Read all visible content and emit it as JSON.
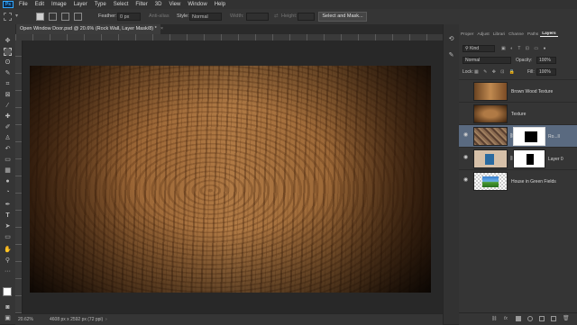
{
  "app": {
    "logo": "Ps"
  },
  "menu": [
    "File",
    "Edit",
    "Image",
    "Layer",
    "Type",
    "Select",
    "Filter",
    "3D",
    "View",
    "Window",
    "Help"
  ],
  "options": {
    "feather_label": "Feather:",
    "feather_value": "0 px",
    "antialias_label": "Anti-alias",
    "style_label": "Style:",
    "style_value": "Normal",
    "width_label": "Width:",
    "height_label": "Height:",
    "select_mask_label": "Select and Mask..."
  },
  "document": {
    "tab_title": "Open Window Door.psd @ 20.6% (Rock Wall, Layer Mask/8) *",
    "close": "×"
  },
  "status": {
    "zoom": "20.62%",
    "doc_size": "4608 px x 2592 px (72 ppi)"
  },
  "panel": {
    "tabs": [
      "Proper",
      "Adjust",
      "Librari",
      "Channe",
      "Paths",
      "Layers"
    ],
    "kind_label": "Kind",
    "blend_mode": "Normal",
    "opacity_label": "Opacity:",
    "opacity_value": "100%",
    "lock_label": "Lock:",
    "fill_label": "Fill:",
    "fill_value": "100%"
  },
  "layers": [
    {
      "name": "Brown Wood Texture",
      "visible": false
    },
    {
      "name": "Texture",
      "visible": false
    },
    {
      "name": "Ro...ll",
      "visible": true,
      "selected": true
    },
    {
      "name": "Layer 0",
      "visible": true
    },
    {
      "name": "House in Green Fields",
      "visible": true
    }
  ],
  "colors": {
    "selection_highlight": "#5a6a80",
    "accent": "#31a8ff",
    "wood_mid": "#b07a45"
  }
}
